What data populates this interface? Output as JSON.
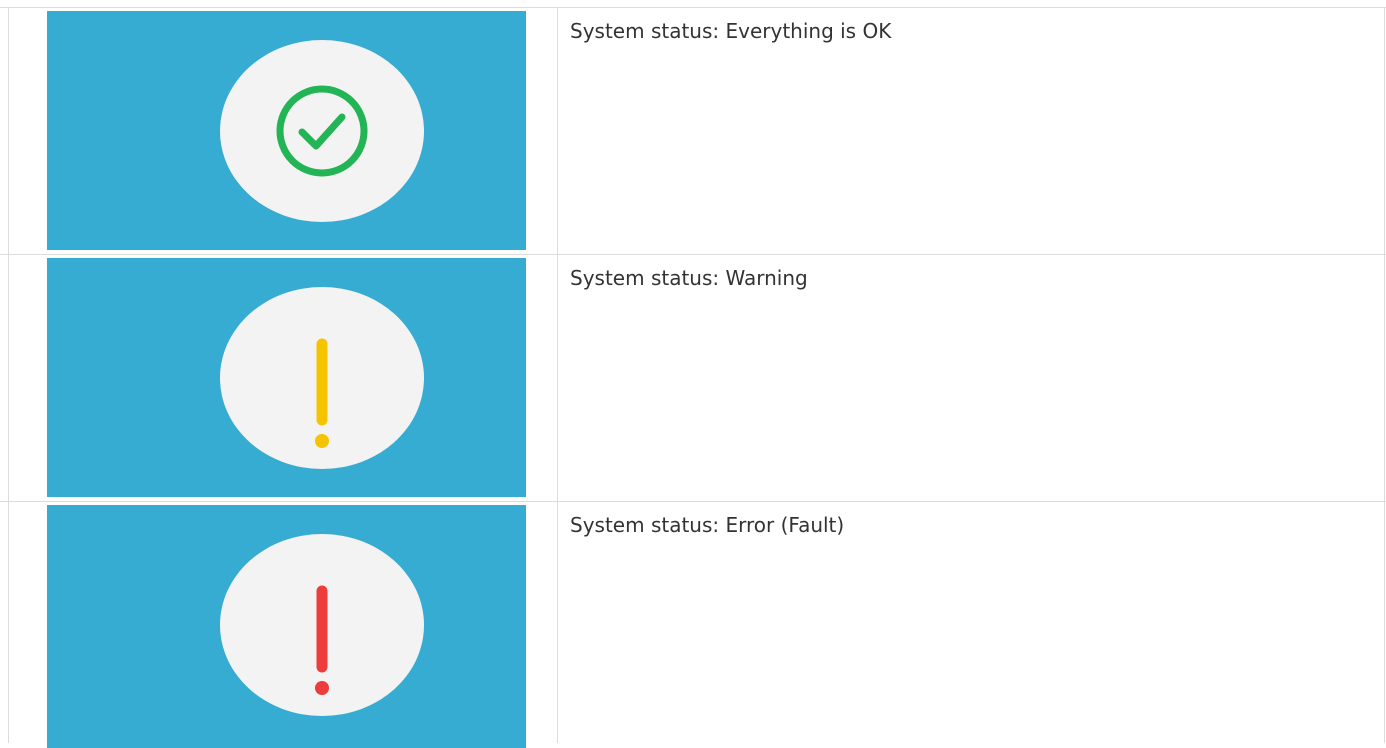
{
  "rows": [
    {
      "status_text": "System status: Everything is OK",
      "icon": "check-circle-icon",
      "icon_color": "#22b455"
    },
    {
      "status_text": "System status: Warning",
      "icon": "exclamation-icon",
      "icon_color": "#f5c400"
    },
    {
      "status_text": "System status: Error (Fault)",
      "icon": "exclamation-icon",
      "icon_color": "#ee3b3b"
    }
  ],
  "colors": {
    "thumbnail_background": "#37acd2",
    "badge_background": "#f3f3f3",
    "grid_line": "#dcdcdc",
    "text": "#333333"
  }
}
